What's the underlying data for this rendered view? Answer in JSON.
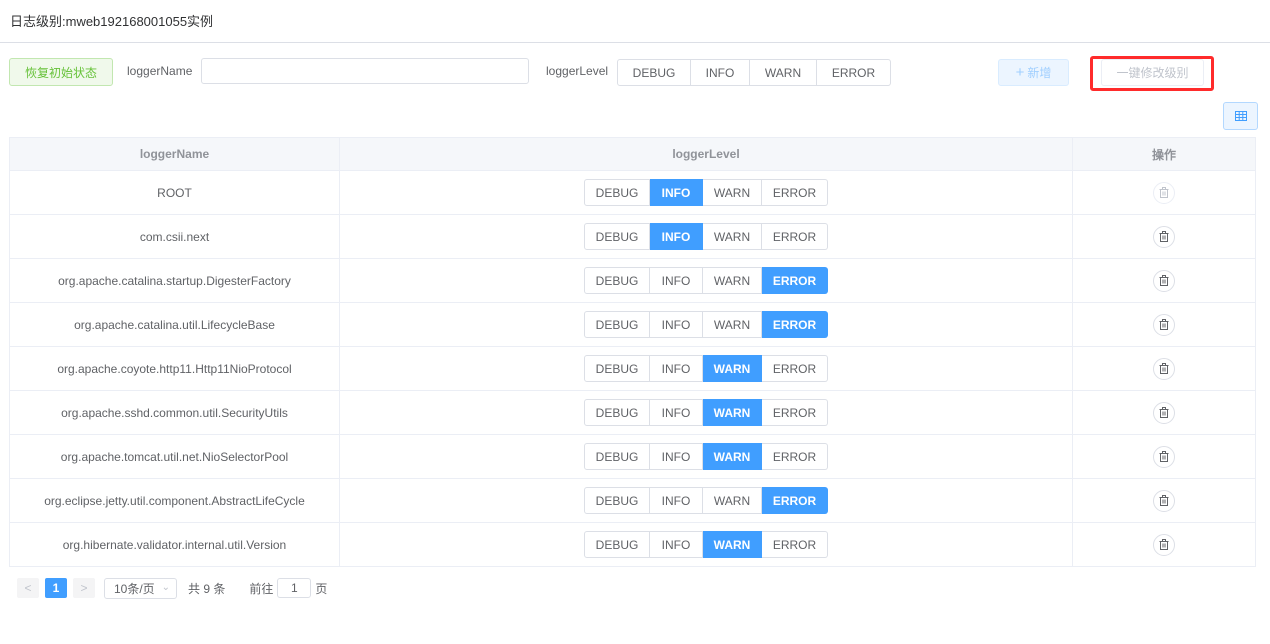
{
  "header": {
    "title": "日志级别:mweb192168001055实例"
  },
  "toolbar": {
    "restore_label": "恢复初始状态",
    "logger_name_label": "loggerName",
    "logger_name_value": "",
    "logger_level_label": "loggerLevel",
    "levels": [
      "DEBUG",
      "INFO",
      "WARN",
      "ERROR"
    ],
    "add_label": "新增",
    "batch_label": "一键修改级别"
  },
  "table": {
    "columns": [
      "loggerName",
      "loggerLevel",
      "操作"
    ],
    "rows": [
      {
        "name": "ROOT",
        "level": "INFO",
        "delete_disabled": true
      },
      {
        "name": "com.csii.next",
        "level": "INFO",
        "delete_disabled": false
      },
      {
        "name": "org.apache.catalina.startup.DigesterFactory",
        "level": "ERROR",
        "delete_disabled": false
      },
      {
        "name": "org.apache.catalina.util.LifecycleBase",
        "level": "ERROR",
        "delete_disabled": false
      },
      {
        "name": "org.apache.coyote.http11.Http11NioProtocol",
        "level": "WARN",
        "delete_disabled": false
      },
      {
        "name": "org.apache.sshd.common.util.SecurityUtils",
        "level": "WARN",
        "delete_disabled": false
      },
      {
        "name": "org.apache.tomcat.util.net.NioSelectorPool",
        "level": "WARN",
        "delete_disabled": false
      },
      {
        "name": "org.eclipse.jetty.util.component.AbstractLifeCycle",
        "level": "ERROR",
        "delete_disabled": false
      },
      {
        "name": "org.hibernate.validator.internal.util.Version",
        "level": "WARN",
        "delete_disabled": false
      }
    ]
  },
  "pagination": {
    "prev": "<",
    "next": ">",
    "current_page": "1",
    "page_size": "10条/页",
    "total": "共 9 条",
    "goto_label": "前往",
    "goto_value": "1",
    "page_unit": "页"
  },
  "colors": {
    "primary": "#409eff",
    "success": "#67c23a",
    "highlight": "#ff2b2b"
  },
  "icons": {
    "add": "plus-icon",
    "grid": "grid-icon",
    "delete": "trash-icon",
    "dropdown": "chevron-down-icon"
  }
}
